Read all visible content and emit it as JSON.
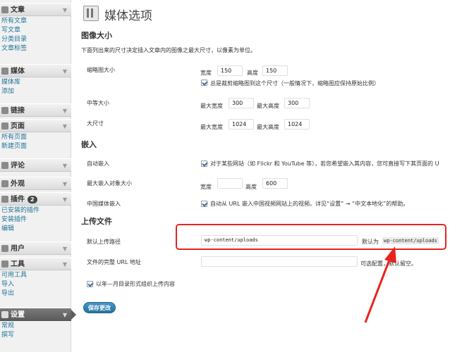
{
  "sidebar": {
    "sections": [
      {
        "label": "文章",
        "icon": "pin-icon",
        "items": [
          "所有文章",
          "写文章",
          "分类目录",
          "文章标签"
        ]
      },
      {
        "label": "媒体",
        "icon": "media-icon",
        "items": [
          "媒体库",
          "添加"
        ]
      },
      {
        "label": "链接",
        "icon": "link-icon",
        "items": []
      },
      {
        "label": "页面",
        "icon": "page-icon",
        "items": [
          "所有页面",
          "新建页面"
        ]
      },
      {
        "label": "评论",
        "icon": "comment-icon",
        "items": []
      },
      {
        "label": "外观",
        "icon": "appearance-icon",
        "items": []
      },
      {
        "label": "插件",
        "icon": "plugin-icon",
        "badge": "2",
        "items": [
          "已安装的插件",
          "安装插件",
          "编辑"
        ]
      },
      {
        "label": "用户",
        "icon": "users-icon",
        "items": []
      },
      {
        "label": "工具",
        "icon": "tools-icon",
        "items": [
          "可用工具",
          "导入",
          "导出"
        ]
      },
      {
        "label": "设置",
        "icon": "settings-icon",
        "current": true,
        "items": [
          "常规",
          "撰写"
        ]
      }
    ]
  },
  "page": {
    "title": "媒体选项"
  },
  "image_size": {
    "heading": "图像大小",
    "description": "下面列出来的尺寸决定插入文章内的图像之最大尺寸，以像素为单位。",
    "thumbnail": {
      "label": "缩略图大小",
      "width_label": "宽度",
      "width": "150",
      "height_label": "高度",
      "height": "150",
      "crop_label": "总是裁剪缩略图到这个尺寸（一般情况下，缩略图应保持原始比例）"
    },
    "medium": {
      "label": "中等大小",
      "max_width_label": "最大宽度",
      "max_width": "300",
      "max_height_label": "最大高度",
      "max_height": "300"
    },
    "large": {
      "label": "大尺寸",
      "max_width_label": "最大宽度",
      "max_width": "1024",
      "max_height_label": "最大高度",
      "max_height": "1024"
    }
  },
  "embeds": {
    "heading": "嵌入",
    "auto": {
      "label": "自动嵌入",
      "text": "对于某些网站（如 Flickr 和 YouTube 等），若您希望嵌入其内容，您可直接写下其页面的 U"
    },
    "max_size": {
      "label": "最大嵌入对象大小",
      "width_label": "宽度",
      "width": "",
      "height_label": "高度",
      "height": "600"
    },
    "china": {
      "label": "中国媒体嵌入",
      "text": "自动从 URL 嵌入中国视频网站上的视频。详见“设置” → “中文本地化”的帮助。"
    }
  },
  "uploads": {
    "heading": "上传文件",
    "path": {
      "label": "默认上传路径",
      "value": "wp-content/uploads",
      "default_prefix": "默认为",
      "default_value": "wp-content/uploads"
    },
    "url": {
      "label": "文件的完整 URL 地址",
      "value": "",
      "note": "可选配置，默认留空。"
    },
    "organize_label": "以年—月目录形式组织上传内容"
  },
  "save_button": "保存更改",
  "colors": {
    "accent": "#21759b",
    "highlight": "#e8231e"
  }
}
